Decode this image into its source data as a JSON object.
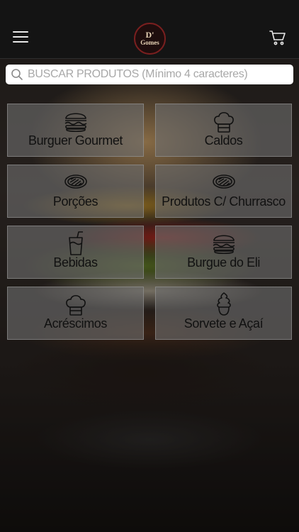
{
  "header": {
    "logo_line1": "D' ",
    "logo_line2": "Gomes"
  },
  "search": {
    "placeholder": "BUSCAR PRODUTOS (Mínimo 4 caracteres)"
  },
  "categories": [
    {
      "label": "Burguer Gourmet",
      "icon": "burger-icon"
    },
    {
      "label": "Caldos",
      "icon": "chef-hat-icon"
    },
    {
      "label": "Porções",
      "icon": "steak-icon"
    },
    {
      "label": "Produtos C/ Churrasco",
      "icon": "steak-icon"
    },
    {
      "label": "Bebidas",
      "icon": "drink-icon"
    },
    {
      "label": "Burgue do Eli",
      "icon": "burger-icon"
    },
    {
      "label": "Acréscimos",
      "icon": "chef-hat-icon"
    },
    {
      "label": "Sorvete e Açaí",
      "icon": "ice-cream-icon"
    }
  ]
}
